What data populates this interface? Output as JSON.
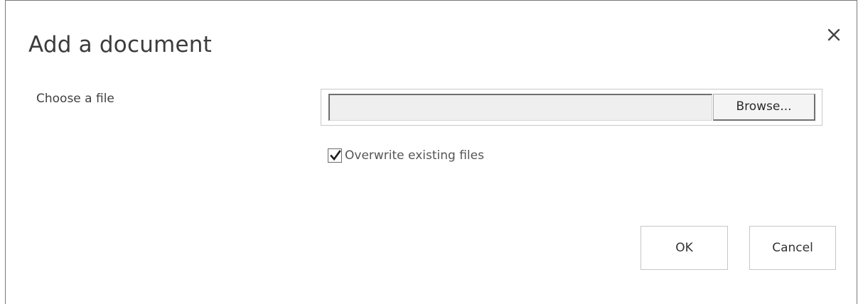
{
  "dialog": {
    "title": "Add a document",
    "close_icon": "close-icon"
  },
  "file_field": {
    "label": "Choose a file",
    "value": "",
    "browse_label": "Browse..."
  },
  "overwrite": {
    "label": "Overwrite existing files",
    "checked": true
  },
  "buttons": {
    "ok_label": "OK",
    "cancel_label": "Cancel"
  },
  "colors": {
    "background": "#ffffff",
    "input_fill": "#efefef",
    "border": "#c6c6c6",
    "text": "#333333"
  }
}
